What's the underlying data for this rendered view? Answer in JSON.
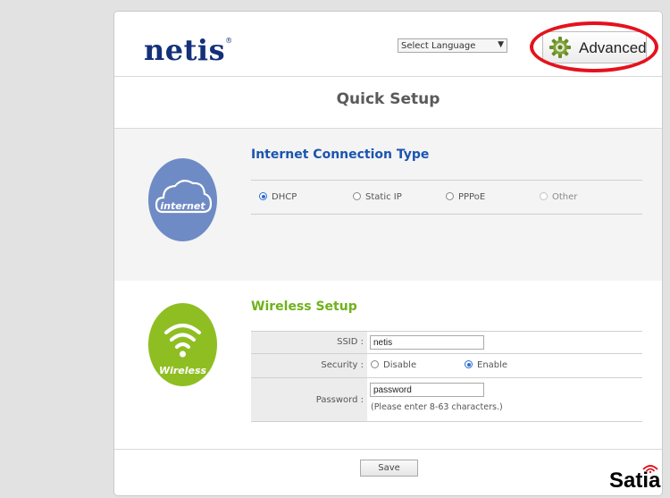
{
  "header": {
    "logo_text": "netis",
    "logo_mark": "®",
    "language_select": {
      "value": "Select Language"
    },
    "advanced_button": {
      "label": "Advanced",
      "icon": "gear-icon"
    }
  },
  "page_title": "Quick Setup",
  "internet": {
    "icon_label": "internet",
    "section_title": "Internet Connection Type",
    "options": [
      {
        "label": "DHCP",
        "selected": true,
        "disabled": false
      },
      {
        "label": "Static IP",
        "selected": false,
        "disabled": false
      },
      {
        "label": "PPPoE",
        "selected": false,
        "disabled": false
      },
      {
        "label": "Other",
        "selected": false,
        "disabled": true
      }
    ]
  },
  "wireless": {
    "icon_label": "Wireless",
    "section_title": "Wireless Setup",
    "ssid_label": "SSID :",
    "ssid_value": "netis",
    "security_label": "Security :",
    "security_options": [
      {
        "label": "Disable",
        "selected": false
      },
      {
        "label": "Enable",
        "selected": true
      }
    ],
    "password_label": "Password :",
    "password_value": "password",
    "password_hint": "(Please enter 8-63 characters.)"
  },
  "save_label": "Save",
  "watermark": "Satia",
  "colors": {
    "logo": "#13307a",
    "internet_circle": "#6f8bc5",
    "wireless_circle": "#8fbe22",
    "internet_title": "#1a55b0",
    "wireless_title": "#6fb21a",
    "highlight_oval": "#e4121e"
  }
}
